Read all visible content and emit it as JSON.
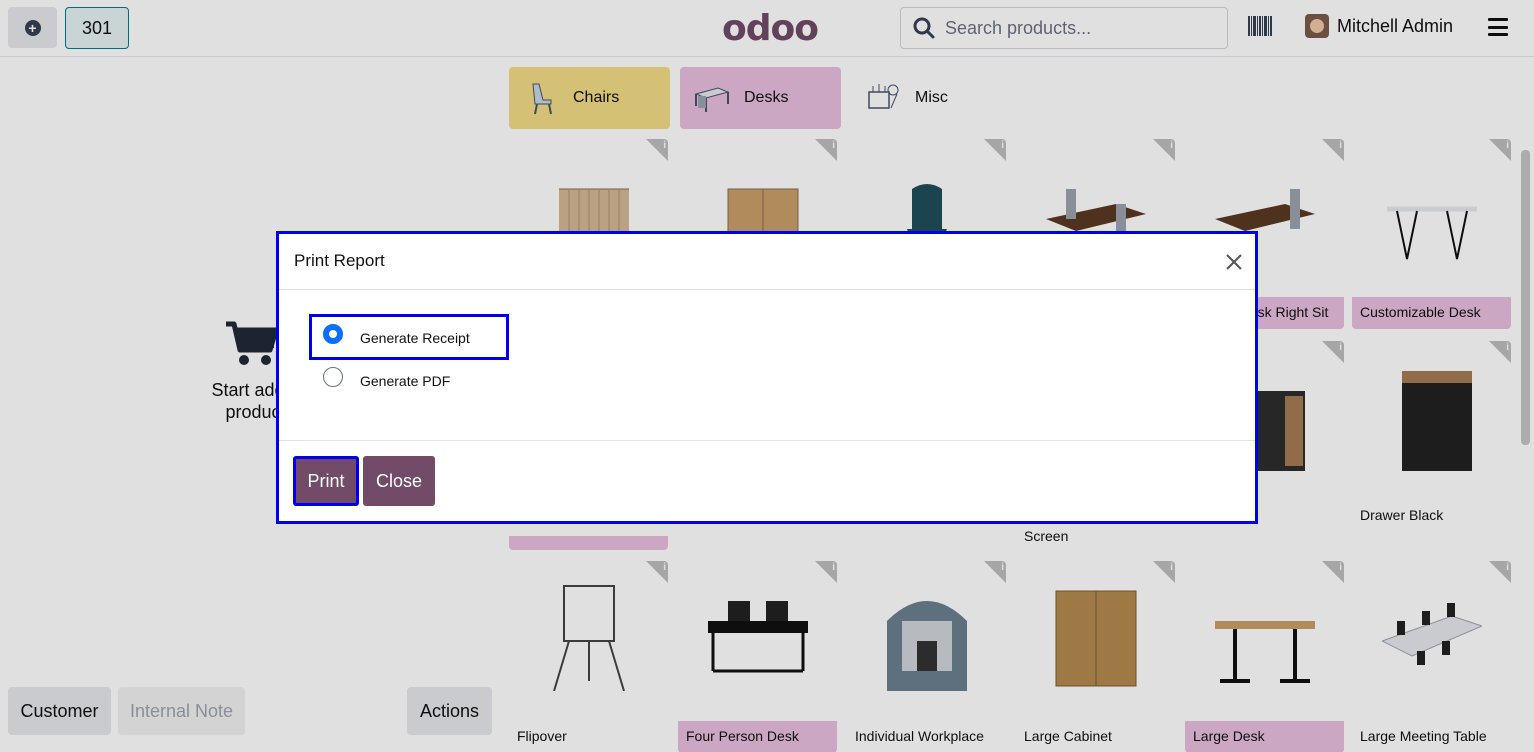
{
  "header": {
    "order_number": "301",
    "logo": "odoo",
    "search_placeholder": "Search products...",
    "user_name": "Mitchell Admin"
  },
  "cart": {
    "empty_text": "Start adding products",
    "customer_button": "Customer",
    "note_button": "Internal Note",
    "actions_button": "Actions"
  },
  "categories": [
    {
      "label": "Chairs",
      "color": "#f3dc86"
    },
    {
      "label": "Desks",
      "color": "#e7bfe0"
    },
    {
      "label": "Misc",
      "color": "#ffffff"
    }
  ],
  "products": {
    "row1": [
      "",
      "",
      "",
      "",
      "Corner Desk Right Sit",
      "Customizable Desk"
    ],
    "row2": [
      "",
      "",
      "",
      "Screen",
      "",
      "Drawer Black"
    ],
    "row3": [
      "Flipover",
      "Four Person Desk",
      "Individual Workplace",
      "Large Cabinet",
      "Large Desk",
      "Large Meeting Table"
    ]
  },
  "modal": {
    "title": "Print Report",
    "option_receipt": "Generate Receipt",
    "option_pdf": "Generate PDF",
    "print_button": "Print",
    "close_button": "Close"
  },
  "colors": {
    "primary": "#714b67",
    "highlight": "#0000ee",
    "radio_checked": "#0d6efd"
  }
}
